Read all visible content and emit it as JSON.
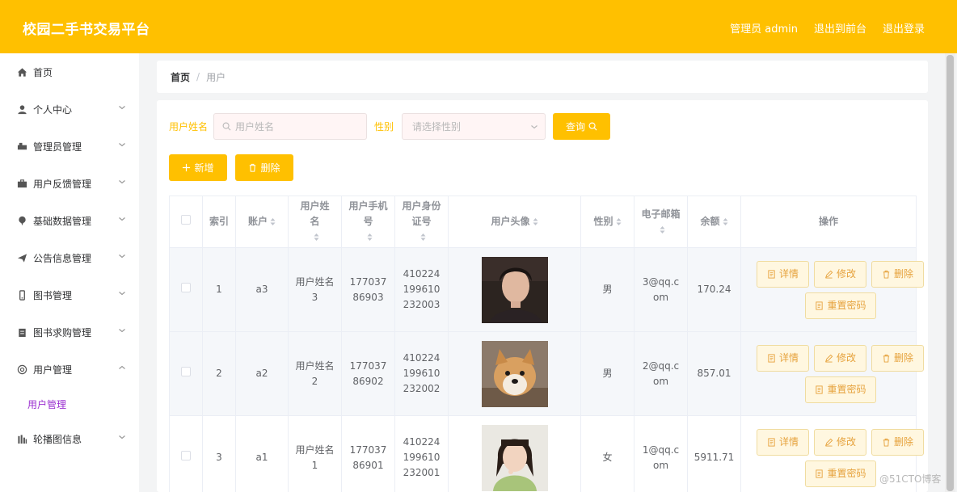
{
  "header": {
    "title": "校园二手书交易平台",
    "admin_label": "管理员 admin",
    "front_label": "退出到前台",
    "logout_label": "退出登录"
  },
  "sidebar": {
    "items": [
      {
        "label": "首页",
        "icon": "home-icon"
      },
      {
        "label": "个人中心",
        "icon": "user-icon"
      },
      {
        "label": "管理员管理",
        "icon": "truck-icon"
      },
      {
        "label": "用户反馈管理",
        "icon": "briefcase-icon"
      },
      {
        "label": "基础数据管理",
        "icon": "pin-icon"
      },
      {
        "label": "公告信息管理",
        "icon": "paper-plane-icon"
      },
      {
        "label": "图书管理",
        "icon": "phone-icon"
      },
      {
        "label": "图书求购管理",
        "icon": "clipboard-icon"
      },
      {
        "label": "用户管理",
        "icon": "settings-circle-icon"
      },
      {
        "label": "轮播图信息",
        "icon": "bar-chart-icon"
      }
    ],
    "active_sub": "用户管理"
  },
  "breadcrumb": {
    "home": "首页",
    "sep": "/",
    "current": "用户"
  },
  "search": {
    "name_label": "用户姓名",
    "name_placeholder": "用户姓名",
    "gender_label": "性别",
    "gender_placeholder": "请选择性别",
    "query_label": "查询"
  },
  "actions": {
    "add_label": "新增",
    "delete_label": "删除"
  },
  "table": {
    "headers": {
      "index": "索引",
      "account": "账户",
      "name": "用户姓名",
      "phone": "用户手机号",
      "idcard": "用户身份证号",
      "avatar": "用户头像",
      "gender": "性别",
      "email": "电子邮箱",
      "balance": "余额",
      "ops": "操作"
    },
    "rows": [
      {
        "index": "1",
        "account": "a3",
        "name": "用户姓名3",
        "phone": "17703786903",
        "idcard": "410224199610232003",
        "gender": "男",
        "email": "3@qq.com",
        "balance": "170.24"
      },
      {
        "index": "2",
        "account": "a2",
        "name": "用户姓名2",
        "phone": "17703786902",
        "idcard": "410224199610232002",
        "gender": "男",
        "email": "2@qq.com",
        "balance": "857.01"
      },
      {
        "index": "3",
        "account": "a1",
        "name": "用户姓名1",
        "phone": "17703786901",
        "idcard": "410224199610232001",
        "gender": "女",
        "email": "1@qq.com",
        "balance": "5911.71"
      }
    ],
    "op_labels": {
      "detail": "详情",
      "edit": "修改",
      "delete": "删除",
      "reset": "重置密码"
    }
  },
  "watermark": "@51CTO博客",
  "colors": {
    "accent": "#ffc000",
    "submenu": "#9b30d0",
    "op_text": "#e6a23c"
  }
}
